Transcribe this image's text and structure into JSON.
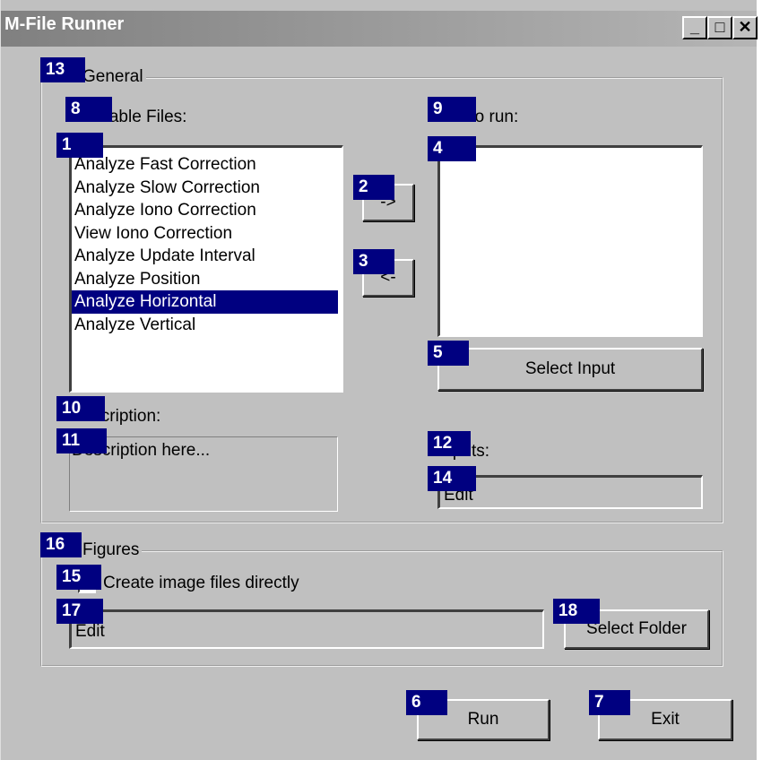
{
  "window": {
    "title": "M-File Runner",
    "minimize": "_",
    "maximize": "□",
    "close": "✕"
  },
  "general": {
    "group_label": "General",
    "available_label": "Available Files:",
    "available_files": [
      "Analyze Fast Correction",
      "Analyze Slow Correction",
      "Analyze Iono Correction",
      "View Iono Correction",
      "Analyze Update Interval",
      "Analyze Position",
      "Analyze Horizontal",
      "Analyze Vertical"
    ],
    "selected_index": 6,
    "add_button": "->",
    "remove_button": "<-",
    "files_to_run_label": "Files to run:",
    "select_input_button": "Select Input",
    "description_label": "Description:",
    "description_text": "Description here...",
    "inputs_label": "Inputs:",
    "inputs_value": "Edit"
  },
  "figures": {
    "group_label": "Figures",
    "checkbox_label": "Create image files directly",
    "checkbox_checked": false,
    "folder_value": "Edit",
    "select_folder_button": "Select Folder"
  },
  "actions": {
    "run_button": "Run",
    "exit_button": "Exit"
  },
  "badges": [
    "1",
    "2",
    "3",
    "4",
    "5",
    "6",
    "7",
    "8",
    "9",
    "10",
    "11",
    "12",
    "13",
    "14",
    "15",
    "16",
    "17",
    "18"
  ]
}
